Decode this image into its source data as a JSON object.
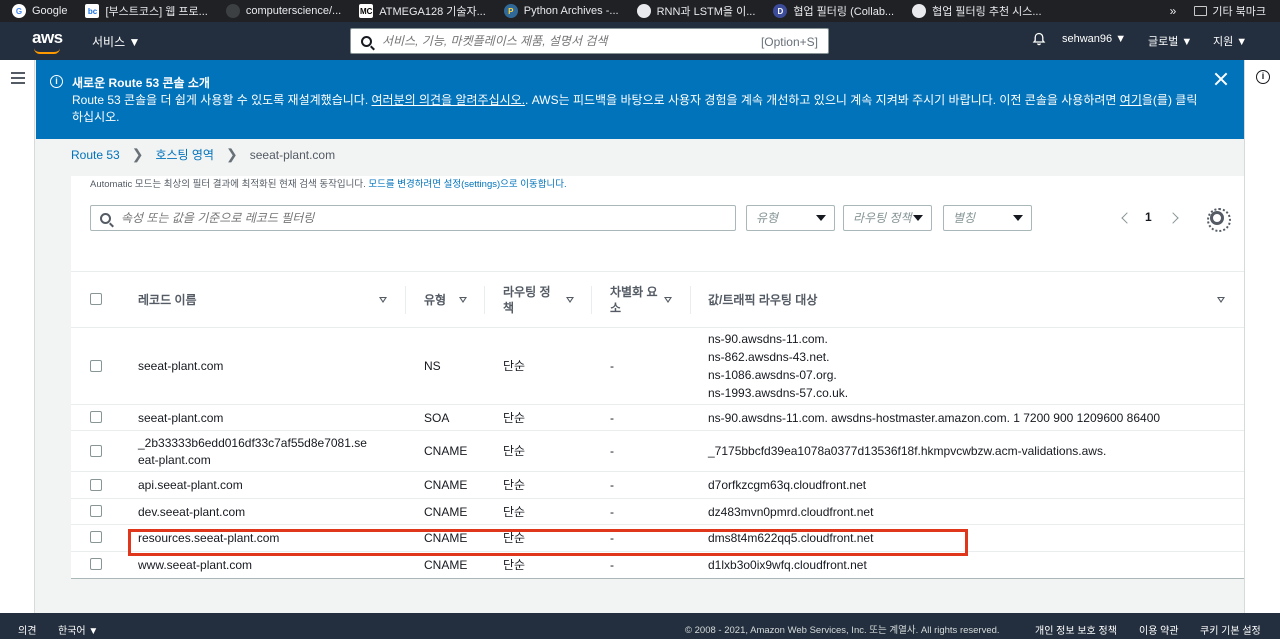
{
  "bookmarks": [
    {
      "label": "Google",
      "icon": "google-icon",
      "color": "#4285f4"
    },
    {
      "label": "[부스트코스] 웹 프로...",
      "icon": "boostcourse-icon",
      "color": "#1a73e8"
    },
    {
      "label": "computerscience/...",
      "icon": "github-icon",
      "color": "#202124"
    },
    {
      "label": "ATMEGA128 기술자...",
      "icon": "mc-icon",
      "color": "#444444"
    },
    {
      "label": "Python Archives -...",
      "icon": "python-icon",
      "color": "#306998"
    },
    {
      "label": "RNN과 LSTM을 이...",
      "icon": "site-icon",
      "color": "#5f6368"
    },
    {
      "label": "협업 필터링 (Collab...",
      "icon": "d-icon",
      "color": "#3c4b9a"
    },
    {
      "label": "협업 필터링 추천 시스...",
      "icon": "site-icon",
      "color": "#5f6368"
    }
  ],
  "bookmarks_more": "»",
  "bookmarks_other": "기타 북마크",
  "topnav": {
    "logo": "aws",
    "services": "서비스 ▼",
    "search_placeholder": "서비스, 기능, 마켓플레이스 제품, 설명서 검색",
    "search_shortcut": "[Option+S]",
    "user": "sehwan96 ▼",
    "region": "글로벌 ▼",
    "support": "지원 ▼"
  },
  "banner": {
    "title": "새로운 Route 53 콘솔 소개",
    "text_before": "Route 53 콘솔을 더 쉽게 사용할 수 있도록 재설계했습니다. ",
    "feedback_link": "여러분의 의견을 알려주십시오.",
    "text_middle": ". AWS는 피드백을 바탕으로 사용자 경험을 계속 개선하고 있으니 계속 지켜봐 주시기 바랍니다. 이전 콘솔을 사용하려면 ",
    "here_link": "여기",
    "text_after": "을(를) 클릭하십시오."
  },
  "breadcrumb": {
    "root": "Route 53",
    "zones": "호스팅 영역",
    "current": "seeat-plant.com"
  },
  "automode": {
    "text": "Automatic 모드는 최상의 필터 결과에 최적화된 현재 검색 동작입니다. ",
    "link": "모드를 변경하려면 설정(settings)으로 이동합니다."
  },
  "filters": {
    "search_placeholder": "속성 또는 값을 기준으로 레코드 필터링",
    "type_select": "유형",
    "policy_select": "라우팅 정책",
    "alias_select": "별칭"
  },
  "pagination": {
    "page": "1"
  },
  "table": {
    "headers": {
      "name": "레코드 이름",
      "type": "유형",
      "policy_l1": "라우팅 정",
      "policy_l2": "책",
      "diff_l1": "차별화 요",
      "diff_l2": "소",
      "value": "값/트래픽 라우팅 대상"
    },
    "rows": [
      {
        "name": "seeat-plant.com",
        "type": "NS",
        "policy": "단순",
        "diff": "-",
        "values": [
          "ns-90.awsdns-11.com.",
          "ns-862.awsdns-43.net.",
          "ns-1086.awsdns-07.org.",
          "ns-1993.awsdns-57.co.uk."
        ]
      },
      {
        "name": "seeat-plant.com",
        "type": "SOA",
        "policy": "단순",
        "diff": "-",
        "value": "ns-90.awsdns-11.com. awsdns-hostmaster.amazon.com. 1 7200 900 1209600 86400"
      },
      {
        "name_l1": "_2b33333b6edd016df33c7af55d8e7081.se",
        "name_l2": "eat-plant.com",
        "type": "CNAME",
        "policy": "단순",
        "diff": "-",
        "value": "_7175bbcfd39ea1078a0377d13536f18f.hkmpvcwbzw.acm-validations.aws."
      },
      {
        "name": "api.seeat-plant.com",
        "type": "CNAME",
        "policy": "단순",
        "diff": "-",
        "value": "d7orfkzcgm63q.cloudfront.net"
      },
      {
        "name": "dev.seeat-plant.com",
        "type": "CNAME",
        "policy": "단순",
        "diff": "-",
        "value": "dz483mvn0pmrd.cloudfront.net"
      },
      {
        "name": "resources.seeat-plant.com",
        "type": "CNAME",
        "policy": "단순",
        "diff": "-",
        "value": "dms8t4m622qq5.cloudfront.net"
      },
      {
        "name": "www.seeat-plant.com",
        "type": "CNAME",
        "policy": "단순",
        "diff": "-",
        "value": "d1lxb3o0ix9wfq.cloudfront.net"
      }
    ]
  },
  "highlight_color": "#e0361c",
  "footer": {
    "feedback": "의견",
    "language": "한국어 ▼",
    "copyright": "© 2008 - 2021, Amazon Web Services, Inc. 또는 계열사. All rights reserved.",
    "privacy": "개인 정보 보호 정책",
    "terms": "이용 약관",
    "cookies": "쿠키 기본 설정"
  }
}
